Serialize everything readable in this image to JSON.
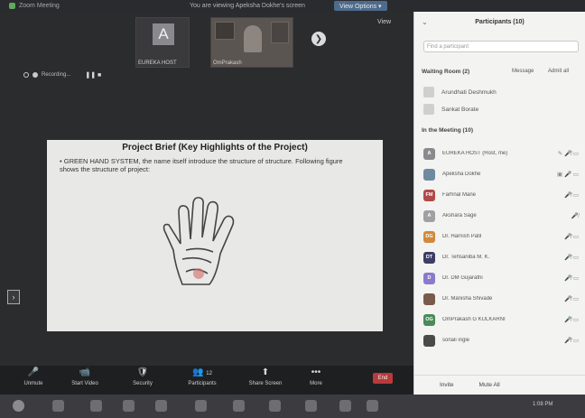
{
  "topbar": {
    "meeting_title": "Zoom Meeting",
    "share_title": "You are viewing Apeksha Dokhe's screen",
    "view_options": "View Options ▾"
  },
  "stage": {
    "thumbnails": [
      {
        "letter": "A",
        "name": "EUREKA HOST"
      },
      {
        "name": "OmPrakash"
      }
    ],
    "view_label": "View",
    "recording_label": "Recording...",
    "recording_controls": "❚❚ ■"
  },
  "slide": {
    "title": "Project Brief (Key Highlights of the Project)",
    "body": "GREEN HAND SYSTEM, the name itself introduce the structure of structure. Following figure shows the structure of project:",
    "bullet": "•"
  },
  "toolbar": {
    "buttons": [
      {
        "label": "Unmute",
        "icon": "🎤"
      },
      {
        "label": "Start Video",
        "icon": "📹"
      },
      {
        "label": "Security",
        "icon": "🛡"
      },
      {
        "label": "Participants",
        "icon": "👥",
        "count": "12"
      },
      {
        "label": "Share Screen",
        "icon": "⬆"
      },
      {
        "label": "More",
        "icon": "•••"
      }
    ],
    "end_label": "End"
  },
  "panel": {
    "title": "Participants (10)",
    "search_placeholder": "Find a participant",
    "waiting_header": "Waiting Room (2)",
    "message_label": "Message",
    "admit_all_label": "Admit all",
    "waiting": [
      {
        "name": "Arundhati Deshmukh"
      },
      {
        "name": "Sankat Borate"
      }
    ],
    "meeting_header": "In the Meeting (10)",
    "participants": [
      {
        "initials": "A",
        "color": "#8a8a8e",
        "name": "EUREKA HOST (Host, me)",
        "icons": "✎ 🎤̸ ▭"
      },
      {
        "initials": "",
        "color": "#6d8aa0",
        "name": "Apeksha Dokhe",
        "icons": "▣ 🎤 ▭"
      },
      {
        "initials": "FM",
        "color": "#b04a4a",
        "name": "Farhnal Mane",
        "icons": "🎤̸ ▭"
      },
      {
        "initials": "A",
        "color": "#a0a0a4",
        "name": "Akshara Sage",
        "icons": "🎤̸"
      },
      {
        "initials": "DG",
        "color": "#d08a3a",
        "name": "Dr. Harnish Patil",
        "icons": "🎤̸ ▭"
      },
      {
        "initials": "DT",
        "color": "#3d3d66",
        "name": "Dr. Tehsaniba M. K.",
        "icons": "🎤̸ ▭"
      },
      {
        "initials": "D",
        "color": "#8a7acb",
        "name": "Dr. DM Gujarathi",
        "icons": "🎤̸ ▭"
      },
      {
        "initials": "",
        "color": "#7a5a4a",
        "name": "Dr. Manisha Shivade",
        "icons": "🎤̸ ▭"
      },
      {
        "initials": "OG",
        "color": "#4a8a5a",
        "name": "OmPrakash G KULKARNI",
        "icons": "🎤̸ ▭"
      },
      {
        "initials": "",
        "color": "#4a4a4a",
        "name": "sonali ingle",
        "icons": "🎤̸ ▭"
      }
    ],
    "invite_label": "Invite",
    "mute_all_label": "Mute All"
  },
  "taskbar": {
    "clock": "1:08 PM"
  }
}
